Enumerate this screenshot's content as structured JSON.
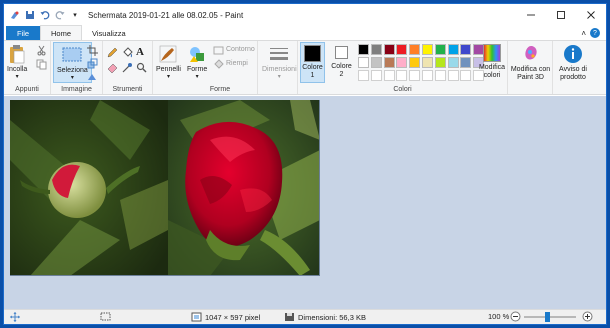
{
  "window": {
    "title": "Schermata 2019-01-21 alle 08.02.05 - Paint"
  },
  "tabs": [
    {
      "label": "File"
    },
    {
      "label": "Home"
    },
    {
      "label": "Visualizza"
    }
  ],
  "ribbon": {
    "clipboard": {
      "paste_label": "Incolla",
      "group_label": "Appunti"
    },
    "image": {
      "select_label": "Seleziona",
      "group_label": "Immagine"
    },
    "tools": {
      "group_label": "Strumenti"
    },
    "shapes": {
      "brushes_label": "Pennelli",
      "shapes_label": "Forme",
      "outline_label": "Contorno",
      "fill_label": "Riempi",
      "group_label": "Forme"
    },
    "size": {
      "label": "Dimensioni"
    },
    "colors": {
      "color1_label": "Colore 1",
      "color2_label": "Colore 2",
      "edit_label": "Modifica colori",
      "group_label": "Colori",
      "color1": "#000000",
      "color2": "#ffffff",
      "palette_row1": [
        "#000000",
        "#7f7f7f",
        "#880015",
        "#ed1c24",
        "#ff7f27",
        "#fff200",
        "#22b14c",
        "#00a2e8",
        "#3f48cc",
        "#a349a4"
      ],
      "palette_row2": [
        "#ffffff",
        "#c3c3c3",
        "#b97a57",
        "#ffaec9",
        "#ffc90e",
        "#efe4b0",
        "#b5e61d",
        "#99d9ea",
        "#7092be",
        "#c8bfe7"
      ]
    },
    "paint3d": {
      "label": "Modifica con Paint 3D"
    },
    "product": {
      "label": "Avviso di prodotto"
    }
  },
  "status": {
    "image_size": "1047 × 597 pixel",
    "file_size": "Dimensioni: 56,3 KB",
    "zoom": "100 %",
    "zoom_fraction": 0.45
  }
}
